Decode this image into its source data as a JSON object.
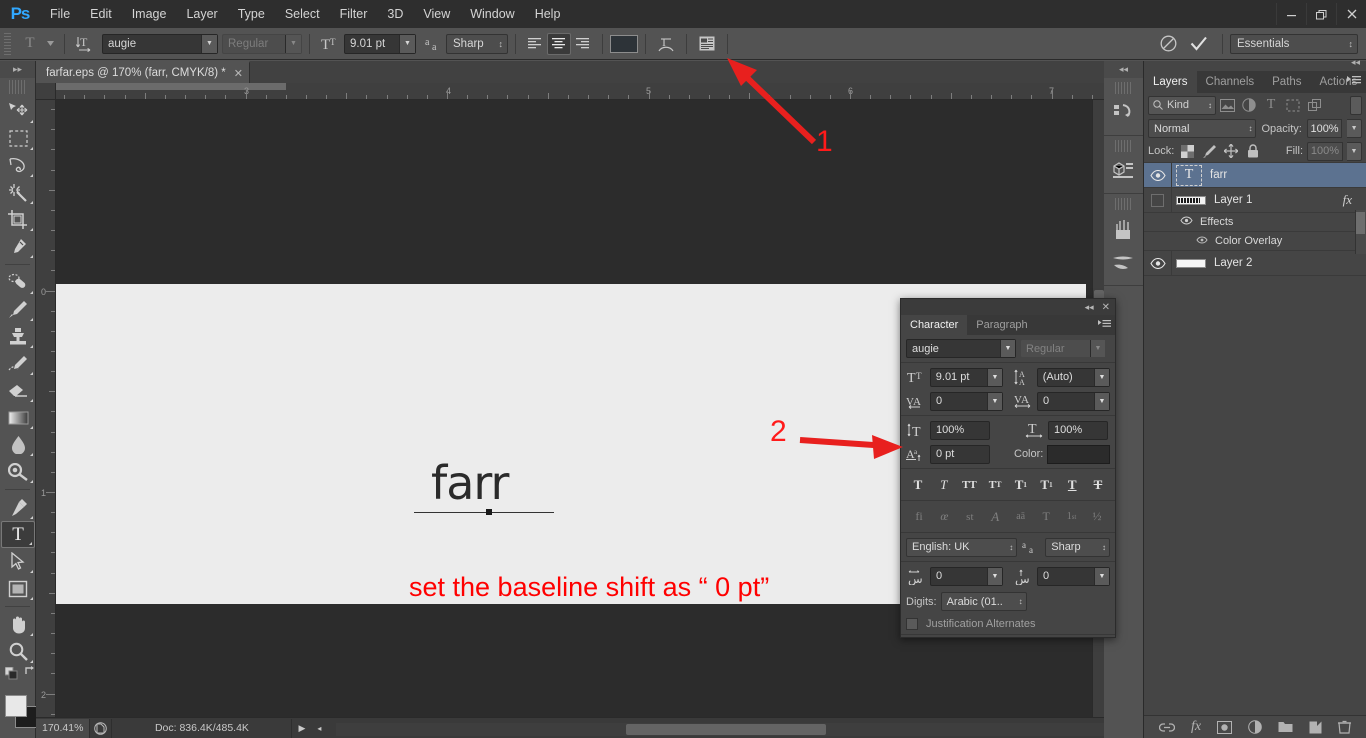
{
  "app": {
    "logo": "Ps",
    "workspace": "Essentials"
  },
  "menubar": {
    "items": [
      "File",
      "Edit",
      "Image",
      "Layer",
      "Type",
      "Select",
      "Filter",
      "3D",
      "View",
      "Window",
      "Help"
    ]
  },
  "window_controls": {
    "minimize": "—",
    "restore": "❐",
    "close": "✕"
  },
  "options_bar": {
    "tool_icon": "type-tool-icon",
    "toggle_orientation_icon": "toggle-text-orientation-icon",
    "font_family": "augie",
    "font_style": "Regular",
    "font_style_placeholder": "Regular",
    "size_icon": "font-size-icon",
    "font_size": "9.01 pt",
    "antialias_icon": "anti-alias-icon",
    "antialias": "Sharp",
    "align_left": "align-left-icon",
    "align_center": "align-center-icon",
    "align_right": "align-right-icon",
    "color_swatch": "#2d3338",
    "warp_icon": "warp-text-icon",
    "panel_toggle_icon": "character-paragraph-panel-icon",
    "cancel_icon": "⃠",
    "commit_icon": "✓"
  },
  "toolbar": {
    "collapse_icon": "▸▸",
    "tools": [
      {
        "name": "move-tool",
        "glyph": "move"
      },
      {
        "name": "rectangular-marquee-tool",
        "glyph": "marquee"
      },
      {
        "name": "lasso-tool",
        "glyph": "lasso"
      },
      {
        "name": "magic-wand-tool",
        "glyph": "wand"
      },
      {
        "name": "crop-tool",
        "glyph": "crop"
      },
      {
        "name": "eyedropper-tool",
        "glyph": "eyedropper"
      },
      {
        "name": "spot-healing-brush-tool",
        "glyph": "healing"
      },
      {
        "name": "brush-tool",
        "glyph": "brush"
      },
      {
        "name": "clone-stamp-tool",
        "glyph": "stamp"
      },
      {
        "name": "history-brush-tool",
        "glyph": "historybrush"
      },
      {
        "name": "eraser-tool",
        "glyph": "eraser"
      },
      {
        "name": "gradient-tool",
        "glyph": "gradient"
      },
      {
        "name": "blur-tool",
        "glyph": "blur"
      },
      {
        "name": "dodge-tool",
        "glyph": "dodge"
      },
      {
        "name": "pen-tool",
        "glyph": "pen"
      },
      {
        "name": "type-tool",
        "glyph": "type",
        "selected": true
      },
      {
        "name": "path-selection-tool",
        "glyph": "pathselect"
      },
      {
        "name": "rectangle-tool",
        "glyph": "rectangle"
      },
      {
        "name": "hand-tool",
        "glyph": "hand"
      },
      {
        "name": "zoom-tool",
        "glyph": "zoom"
      }
    ],
    "foreground_color": "#e8e8e8",
    "background_color": "#1d1d1d"
  },
  "document": {
    "tab_title": "farfar.eps @ 170% (farr, CMYK/8) *",
    "tab_close": "✕",
    "h_ruler_labels": [
      "3",
      "4",
      "5",
      "6",
      "7"
    ],
    "v_ruler_labels": [
      "0",
      "1",
      "2"
    ],
    "canvas_text": "farr"
  },
  "annotations": {
    "label_1": "1",
    "label_2": "2",
    "note": "set the baseline shift as “ 0 pt”",
    "color": "#ff0000"
  },
  "status_bar": {
    "zoom": "170.41%",
    "proxy_icon": "document-proxy-icon",
    "doc_size": "Doc: 836.4K/485.4K",
    "play_icon": "▶",
    "left_arrow": "◂"
  },
  "dock_rail": {
    "collapse_icon": "◂◂",
    "icons": [
      {
        "name": "history-panel-icon"
      },
      {
        "name": "properties-panel-icon"
      },
      {
        "name": "brush-presets-panel-icon"
      },
      {
        "name": "brush-panel-icon"
      }
    ]
  },
  "layers_panel": {
    "collapse_icon": "◂◂",
    "tabs": [
      {
        "label": "Layers",
        "active": true
      },
      {
        "label": "Channels",
        "active": false
      },
      {
        "label": "Paths",
        "active": false
      },
      {
        "label": "Actions",
        "active": false
      }
    ],
    "menu_icon": "≡",
    "filter": {
      "search_icon": "search-icon",
      "kind_label": "Kind",
      "icons": [
        "filter-pixel-icon",
        "filter-adjustment-icon",
        "filter-type-icon",
        "filter-shape-icon",
        "filter-smart-object-icon"
      ]
    },
    "blend_mode": "Normal",
    "opacity_label": "Opacity:",
    "opacity_value": "100%",
    "lock_label": "Lock:",
    "lock_icons": [
      "lock-transparent-pixels-icon",
      "lock-image-pixels-icon",
      "lock-position-icon",
      "lock-all-icon"
    ],
    "fill_label": "Fill:",
    "fill_value": "100%",
    "layers": [
      {
        "name": "farr",
        "type": "text",
        "visible": true,
        "selected": true
      },
      {
        "name": "Layer 1",
        "type": "image",
        "visible": false,
        "selected": false,
        "fx": "fx"
      },
      {
        "name": "Effects",
        "type": "effects-group",
        "visible": true,
        "indent": 1
      },
      {
        "name": "Color Overlay",
        "type": "effect",
        "visible": true,
        "indent": 2
      },
      {
        "name": "Layer 2",
        "type": "image",
        "visible": true,
        "selected": false
      }
    ],
    "footer_icons": [
      {
        "name": "link-layers-icon",
        "glyph": "⧉"
      },
      {
        "name": "layer-style-fx-icon",
        "glyph": "fx"
      },
      {
        "name": "add-layer-mask-icon",
        "glyph": "mask"
      },
      {
        "name": "new-adjustment-layer-icon",
        "glyph": "adjust"
      },
      {
        "name": "new-group-icon",
        "glyph": "folder"
      },
      {
        "name": "new-layer-icon",
        "glyph": "newlayer"
      },
      {
        "name": "delete-layer-icon",
        "glyph": "trash"
      }
    ]
  },
  "character_panel": {
    "collapse_icon": "◂◂",
    "close_icon": "✕",
    "menu_icon": "≡",
    "tabs": [
      {
        "label": "Character",
        "active": true
      },
      {
        "label": "Paragraph",
        "active": false
      }
    ],
    "font_family": "augie",
    "font_style": "Regular",
    "font_size_icon": "font-size-icon",
    "font_size": "9.01 pt",
    "leading_icon": "leading-icon",
    "leading": "(Auto)",
    "kerning_icon": "kerning-icon",
    "kerning": "0",
    "tracking_icon": "tracking-icon",
    "tracking": "0",
    "vertical_scale_icon": "vertical-scale-icon",
    "vertical_scale": "100%",
    "horizontal_scale_icon": "horizontal-scale-icon",
    "horizontal_scale": "100%",
    "baseline_shift_icon": "baseline-shift-icon",
    "baseline_shift": "0 pt",
    "color_label": "Color:",
    "color_value": "#2b2b2b",
    "style_buttons": [
      {
        "name": "faux-bold-button",
        "glyph": "T"
      },
      {
        "name": "faux-italic-button",
        "glyph": "T"
      },
      {
        "name": "all-caps-button",
        "glyph": "TT"
      },
      {
        "name": "small-caps-button",
        "glyph": "Tᴛ"
      },
      {
        "name": "superscript-button",
        "glyph": "T¹"
      },
      {
        "name": "subscript-button",
        "glyph": "T₁"
      },
      {
        "name": "underline-button",
        "glyph": "T"
      },
      {
        "name": "strikethrough-button",
        "glyph": "T"
      }
    ],
    "opentype_buttons": [
      {
        "name": "standard-ligatures-button",
        "glyph": "fi"
      },
      {
        "name": "contextual-alternates-button",
        "glyph": "œ"
      },
      {
        "name": "discretionary-ligatures-button",
        "glyph": "st"
      },
      {
        "name": "swash-button",
        "glyph": "𝒜"
      },
      {
        "name": "stylistic-alternates-button",
        "glyph": "aā"
      },
      {
        "name": "titling-alternates-button",
        "glyph": "T"
      },
      {
        "name": "ordinals-button",
        "glyph": "1st"
      },
      {
        "name": "fractions-button",
        "glyph": "½"
      }
    ],
    "language": "English: UK",
    "antialias_icon": "anti-alias-icon",
    "antialias": "Sharp",
    "arabic_kashida_icon": "kashida-icon",
    "arabic_kashida": "0",
    "arabic_diacritics_icon": "diacritics-icon",
    "arabic_diacritics": "0",
    "digits_label": "Digits:",
    "digits_value": "Arabic (01..",
    "justification_alternates_label": "Justification Alternates"
  }
}
